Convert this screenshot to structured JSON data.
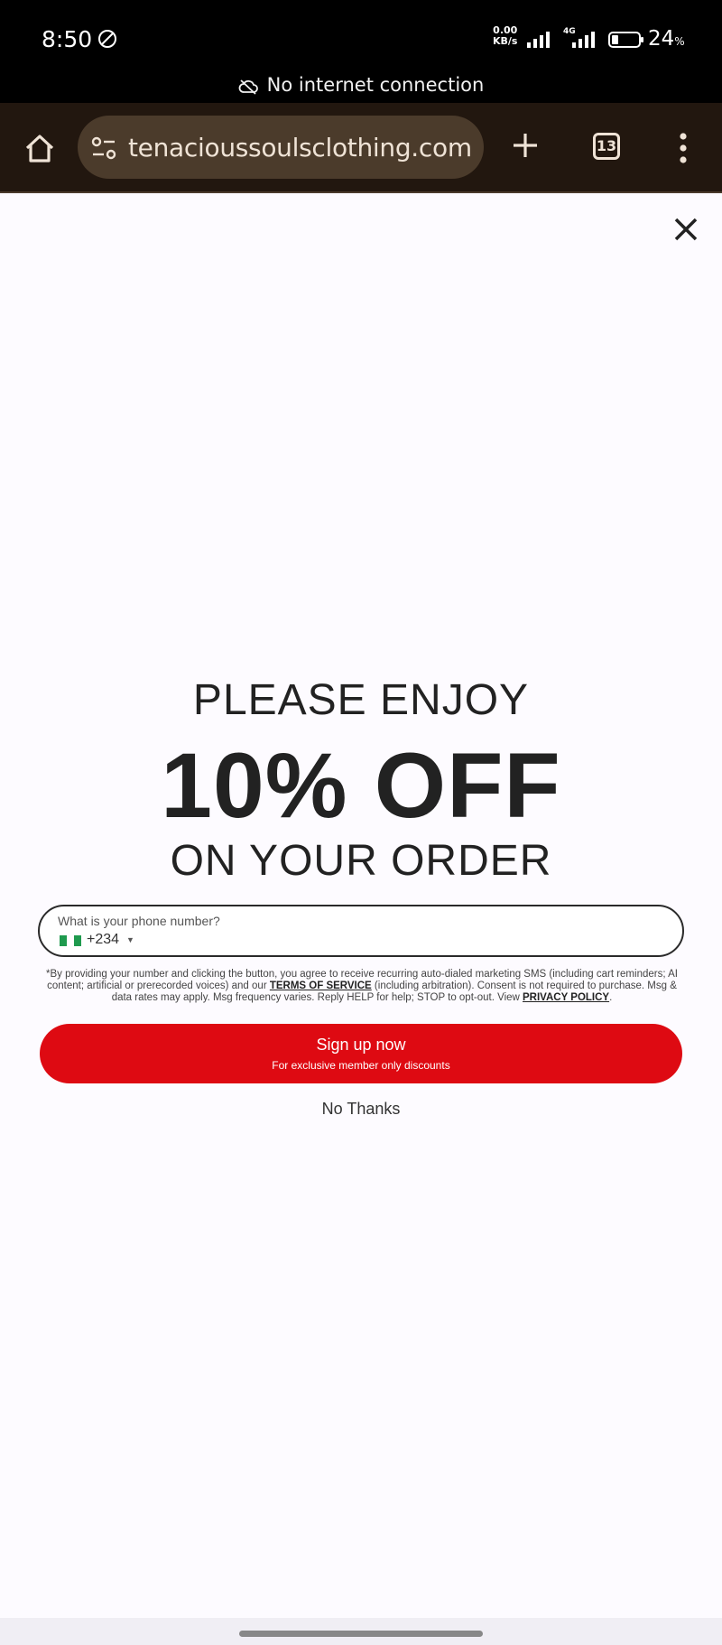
{
  "status_bar": {
    "time": "8:50",
    "net_speed_value": "0.00",
    "net_speed_unit": "KB/s",
    "network_type": "4G",
    "battery_percent": "24",
    "battery_unit": "%",
    "offline_message": "No internet connection"
  },
  "browser": {
    "url": "tenacioussoulsclothing.com",
    "tab_count": "13"
  },
  "popup": {
    "headline_top": "PLEASE ENJOY",
    "headline_main": "10% OFF",
    "headline_bottom": "ON YOUR ORDER",
    "phone_label": "What is your phone number?",
    "country_code": "+234",
    "disclaimer_part1": "*By providing your number and clicking the button, you agree to receive recurring auto-dialed marketing SMS (including cart reminders; AI content; artificial or prerecorded voices) and our ",
    "terms_link": "TERMS OF SERVICE",
    "disclaimer_part2": " (including arbitration). Consent is not required to purchase. Msg & data rates may apply. Msg frequency varies. Reply HELP for help; STOP to opt-out. View ",
    "privacy_link": "PRIVACY POLICY",
    "disclaimer_end": ".",
    "signup_label": "Sign up now",
    "signup_sublabel": "For exclusive member only discounts",
    "decline_label": "No Thanks"
  },
  "colors": {
    "toolbar_bg": "#22170f",
    "url_pill_bg": "#4b3b2b",
    "cta_red": "#de0a12",
    "flag_green": "#1f9a4e"
  }
}
